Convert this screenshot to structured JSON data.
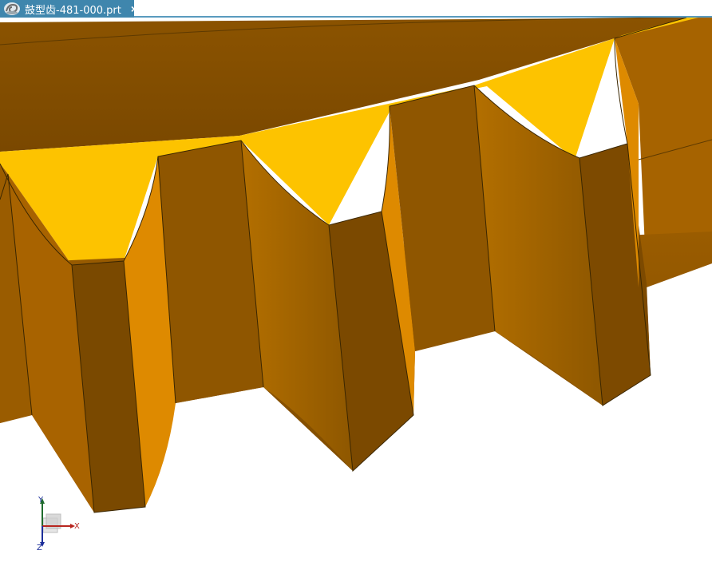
{
  "tab": {
    "title": "鼓型齿-481-000.prt",
    "close_label": "×",
    "icon": "part-file-icon"
  },
  "triad": {
    "x_label": "X",
    "y_label": "Y",
    "z_label": "Z"
  },
  "colors": {
    "tab_bg": "#3f86ad",
    "gear_top": "#fdc300",
    "gear_face_dark": "#8a5400",
    "gear_face_mid": "#a86300",
    "gear_face_light": "#d98a00",
    "edge": "#3a2600"
  }
}
